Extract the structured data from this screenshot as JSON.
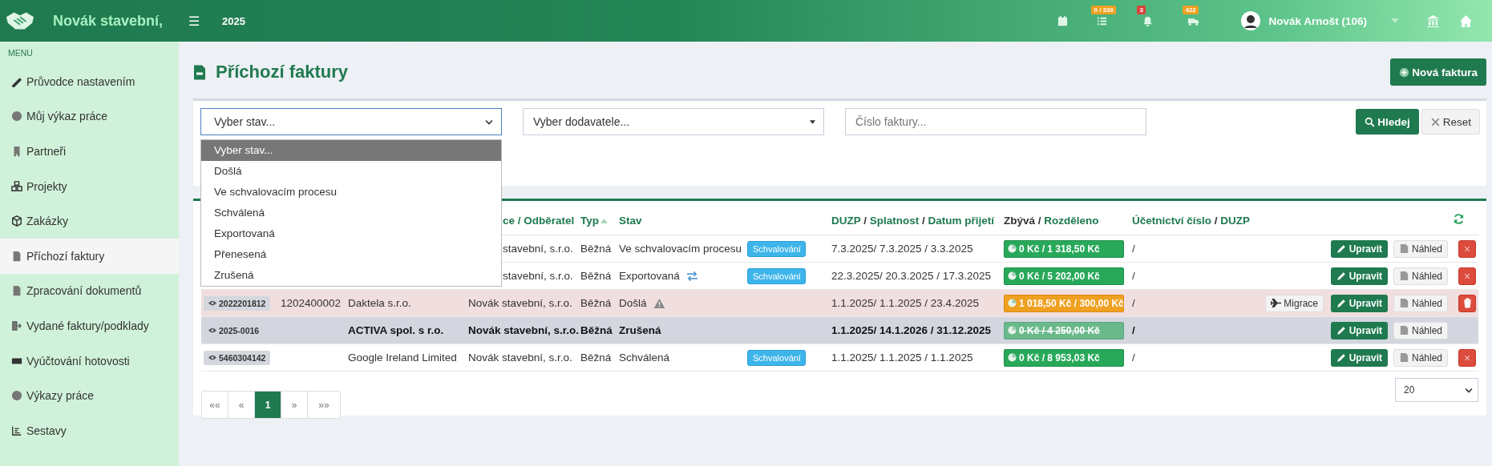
{
  "topbar": {
    "brand": "Novák stavební,",
    "menu_icon": "☰",
    "year": "2025",
    "indicators": [
      {
        "kind": "tasks",
        "count": "0 / 336",
        "color": "#f0a020"
      },
      {
        "kind": "bell",
        "count": "3",
        "color": "#d9423a"
      },
      {
        "kind": "truck",
        "count": "422",
        "color": "#f0a020"
      }
    ],
    "user": "Novák Arnošt (106)"
  },
  "sidebar": {
    "heading": "MENU",
    "items": [
      {
        "label": "Průvodce nastavením",
        "selected": false
      },
      {
        "label": "Můj výkaz práce",
        "selected": false
      },
      {
        "label": "Partneři",
        "selected": false
      },
      {
        "label": "Projekty",
        "selected": false
      },
      {
        "label": "Zakázky",
        "selected": false
      },
      {
        "label": "Příchozí faktury",
        "selected": true
      },
      {
        "label": "Zpracování dokumentů",
        "selected": false
      },
      {
        "label": "Vydané faktury/podklady",
        "selected": false
      },
      {
        "label": "Vyúčtování hotovosti",
        "selected": false
      },
      {
        "label": "Výkazy práce",
        "selected": false
      },
      {
        "label": "Sestavy",
        "selected": false
      }
    ]
  },
  "page": {
    "title": "Příchozí faktury",
    "new_button": "Nová faktura"
  },
  "filters": {
    "state_select": {
      "value": "Vyber stav...",
      "expanded": true,
      "options": [
        {
          "label": "Vyber stav...",
          "selected": true
        },
        {
          "label": "Došlá",
          "selected": false
        },
        {
          "label": "Ve schvalovacím procesu",
          "selected": false
        },
        {
          "label": "Schválená",
          "selected": false
        },
        {
          "label": "Exportovaná",
          "selected": false
        },
        {
          "label": "Přenesená",
          "selected": false
        },
        {
          "label": "Zrušená",
          "selected": false
        }
      ]
    },
    "supplier_select": {
      "value": "Vyber dodavatele..."
    },
    "invoice_number": {
      "placeholder": "Číslo faktury..."
    },
    "search_button": "Hledej",
    "reset_button": "Reset"
  },
  "table": {
    "columns": [
      {},
      {},
      {},
      {
        "parts": [
          {
            "text": "ce / Odběratel",
            "link": true
          }
        ],
        "cut": true
      },
      {
        "parts": [
          {
            "text": "Typ",
            "link": true
          }
        ],
        "sorted": true
      },
      {
        "parts": [
          {
            "text": "Stav",
            "link": true
          }
        ]
      },
      {},
      {
        "parts": [
          {
            "text": "DUZP",
            "link": true
          },
          {
            "text": " / ",
            "link": false
          },
          {
            "text": "Splatnost",
            "link": true
          },
          {
            "text": " / ",
            "link": false
          },
          {
            "text": "Datum přijetí",
            "link": true
          }
        ]
      },
      {
        "parts": [
          {
            "text": "Zbývá",
            "link": false
          },
          {
            "text": " / ",
            "link": false
          },
          {
            "text": "Rozděleno",
            "link": true
          }
        ]
      },
      {
        "parts": [
          {
            "text": "Účetnictví číslo",
            "link": true
          },
          {
            "text": " / ",
            "link": false
          },
          {
            "text": "DUZP",
            "link": true
          }
        ]
      },
      {},
      {},
      {},
      {
        "refresh": true
      }
    ],
    "rows": [
      {
        "kind": "normal",
        "customer": "stavební, s.r.o.",
        "customer_cut": true,
        "type": "Běžná",
        "state": "Ve schvalovacím procesu",
        "approval": "Schvalování",
        "dates": "7.3.2025/ 7.3.2025 / 3.3.2025",
        "amount": {
          "kind": "paid",
          "text": "0 Kč / 1 318,50 Kč"
        },
        "account": "/",
        "edit": "Upravit",
        "preview": "Náhled",
        "delete": {
          "kind": "cross",
          "label": "×"
        }
      },
      {
        "kind": "normal",
        "customer": "stavební, s.r.o.",
        "customer_cut": true,
        "type": "Běžná",
        "state": "Exportovaná",
        "exported_icon": true,
        "approval": "Schvalování",
        "dates": "22.3.2025/ 20.3.2025 / 17.3.2025",
        "amount": {
          "kind": "paid",
          "text": "0 Kč / 5 202,00 Kč"
        },
        "account": "/",
        "edit": "Upravit",
        "preview": "Náhled",
        "delete": {
          "kind": "cross",
          "label": "×"
        }
      },
      {
        "kind": "warning",
        "id": "2022201812",
        "number": "1202400002",
        "supplier": "Daktela s.r.o.",
        "customer": "Novák stavební, s.r.o.",
        "type": "Běžná",
        "state": "Došlá",
        "warning_icon": true,
        "dates": "1.1.2025/ 1.1.2025 / 23.4.2025",
        "amount": {
          "kind": "partial",
          "text": "1 018,50 Kč / 300,00 Kč"
        },
        "account": "/",
        "migrate": "Migrace",
        "edit": "Upravit",
        "preview": "Náhled",
        "delete": {
          "kind": "trash"
        }
      },
      {
        "kind": "cancelled",
        "id": "2025-0016",
        "supplier": "ACTIVA spol. s r.o.",
        "customer": "Novák stavební, s.r.o.",
        "type": "Běžná",
        "state": "Zrušená",
        "dates": "1.1.2025/ 14.1.2026 / 31.12.2025",
        "amount": {
          "kind": "void",
          "text": "0 Kč / 4 250,00 Kč"
        },
        "account": "/",
        "edit": "Upravit",
        "preview": "Náhled"
      },
      {
        "kind": "normal",
        "id": "5460304142",
        "supplier": "Google Ireland Limited",
        "customer": "Novák stavební, s.r.o.",
        "type": "Běžná",
        "state": "Schválená",
        "approval": "Schvalování",
        "dates": "1.1.2025/ 1.1.2025 / 1.1.2025",
        "amount": {
          "kind": "paid",
          "text": "0 Kč / 8 953,03 Kč"
        },
        "account": "/",
        "edit": "Upravit",
        "preview": "Náhled",
        "delete": {
          "kind": "cross",
          "label": "×"
        }
      }
    ]
  },
  "pagination": {
    "pages": [
      {
        "label": "««",
        "selected": false
      },
      {
        "label": "«",
        "selected": false
      },
      {
        "label": "1",
        "selected": true
      },
      {
        "label": "»",
        "selected": false
      },
      {
        "label": "»»",
        "selected": false
      }
    ],
    "page_size": "20"
  }
}
